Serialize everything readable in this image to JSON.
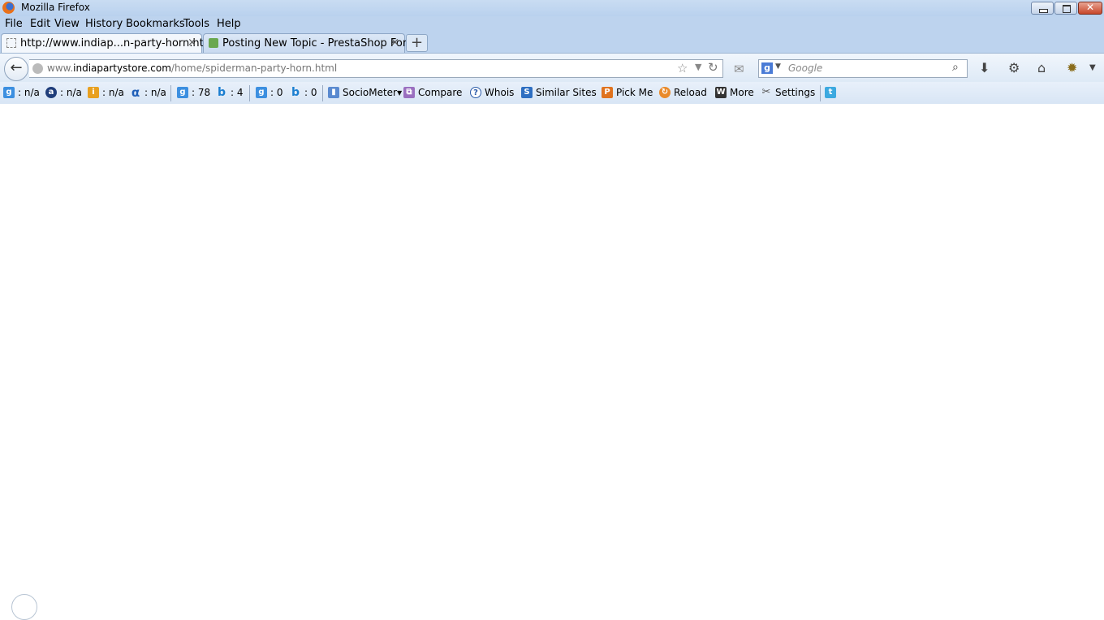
{
  "window": {
    "title": "Mozilla Firefox"
  },
  "menu": [
    "File",
    "Edit",
    "View",
    "History",
    "Bookmarks",
    "Tools",
    "Help"
  ],
  "tabs": [
    {
      "label": "http://www.indiap...n-party-horn.html",
      "close": "×"
    },
    {
      "label": "Posting New Topic - PrestaShop Foru...",
      "close": "×"
    }
  ],
  "new_tab": "+",
  "address": {
    "prefix": "www.",
    "domain": "indiapartystore.com",
    "path": "/home/spiderman-party-horn.html"
  },
  "search": {
    "placeholder": "Google",
    "engine_letter": "g"
  },
  "seobar": {
    "google_pr": ": n/a",
    "alexa": ": n/a",
    "compete": ": n/a",
    "alpha": ": n/a",
    "google_index": ": 78",
    "bing_index": ": 4",
    "google_links": ": 0",
    "bing_links": ": 0",
    "sociometer": "SocioMeter",
    "compare": "Compare",
    "whois": "Whois",
    "similar": "Similar Sites",
    "pickme": "Pick Me",
    "reload": "Reload",
    "more": "More",
    "settings": "Settings"
  },
  "colors": {
    "chrome": "#bdd3ee",
    "accent": "#4a7bd6"
  }
}
